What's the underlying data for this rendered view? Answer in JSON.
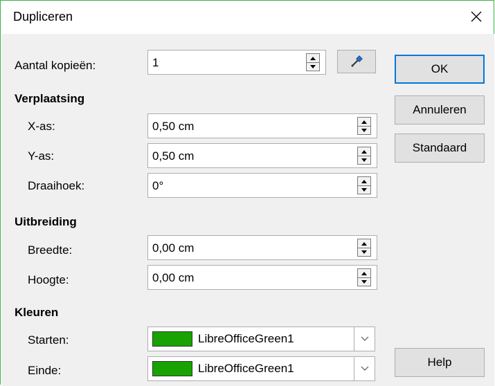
{
  "dialog": {
    "title": "Dupliceren"
  },
  "copies": {
    "label": "Aantal kopieën:",
    "value": "1"
  },
  "placement": {
    "heading": "Verplaatsing",
    "x_label": "X-as:",
    "x_value": "0,50 cm",
    "y_label": "Y-as:",
    "y_value": "0,50 cm",
    "angle_label": "Draaihoek:",
    "angle_value": "0°"
  },
  "enlargement": {
    "heading": "Uitbreiding",
    "width_label": "Breedte:",
    "width_value": "0,00 cm",
    "height_label": "Hoogte:",
    "height_value": "0,00 cm"
  },
  "colors": {
    "heading": "Kleuren",
    "start_label": "Starten:",
    "start_value": "LibreOfficeGreen1",
    "start_color": "#18a303",
    "end_label": "Einde:",
    "end_value": "LibreOfficeGreen1",
    "end_color": "#18a303"
  },
  "buttons": {
    "ok": "OK",
    "cancel": "Annuleren",
    "default": "Standaard",
    "help": "Help"
  },
  "icons": {
    "close": "close-icon",
    "picker": "eyedropper-icon"
  },
  "accent": {
    "window_border": "#3cb043",
    "focus": "#0078d7"
  }
}
